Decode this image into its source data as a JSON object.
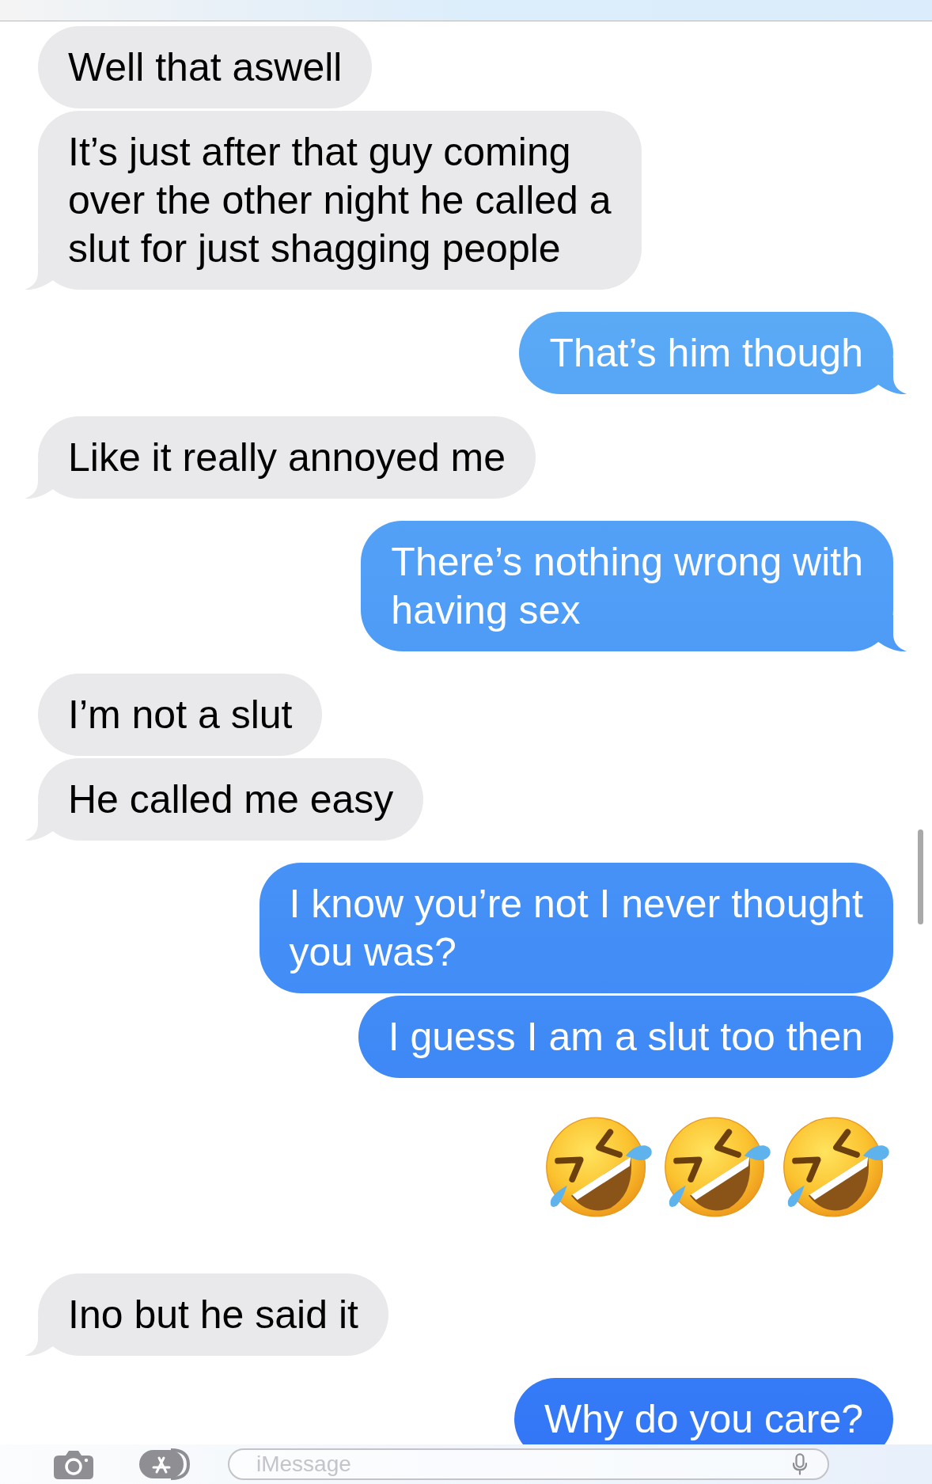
{
  "messages": [
    {
      "kind": "text",
      "from_me": false,
      "tail": false,
      "lines": [
        "Well that aswell"
      ]
    },
    {
      "kind": "text",
      "from_me": false,
      "tail": true,
      "lines": [
        "It’s just after that guy coming",
        "over the other night he called a",
        "slut for just shagging people"
      ]
    },
    {
      "kind": "text",
      "from_me": true,
      "tail": true,
      "lines": [
        "That’s him though"
      ]
    },
    {
      "kind": "text",
      "from_me": false,
      "tail": true,
      "lines": [
        "Like it really annoyed me"
      ]
    },
    {
      "kind": "text",
      "from_me": true,
      "tail": true,
      "lines": [
        "There’s nothing wrong with",
        "having sex"
      ]
    },
    {
      "kind": "text",
      "from_me": false,
      "tail": false,
      "lines": [
        "I’m not a slut"
      ]
    },
    {
      "kind": "text",
      "from_me": false,
      "tail": true,
      "lines": [
        "He called me easy"
      ]
    },
    {
      "kind": "text",
      "from_me": true,
      "tail": false,
      "lines": [
        "I know you’re not I never thought",
        "you was?"
      ]
    },
    {
      "kind": "text",
      "from_me": true,
      "tail": false,
      "lines": [
        "I guess I am a slut too then"
      ]
    },
    {
      "kind": "emoji",
      "from_me": true,
      "emoji": [
        {
          "kind": "rolling_laughing"
        },
        {
          "kind": "rolling_laughing"
        },
        {
          "kind": "rolling_laughing"
        }
      ]
    },
    {
      "kind": "text",
      "from_me": false,
      "tail": true,
      "lines": [
        "Ino but he said it"
      ]
    },
    {
      "kind": "text",
      "from_me": true,
      "tail": false,
      "lines": [
        "Why do you care?"
      ]
    }
  ],
  "compose_bar": {
    "placeholder": "iMessage"
  }
}
